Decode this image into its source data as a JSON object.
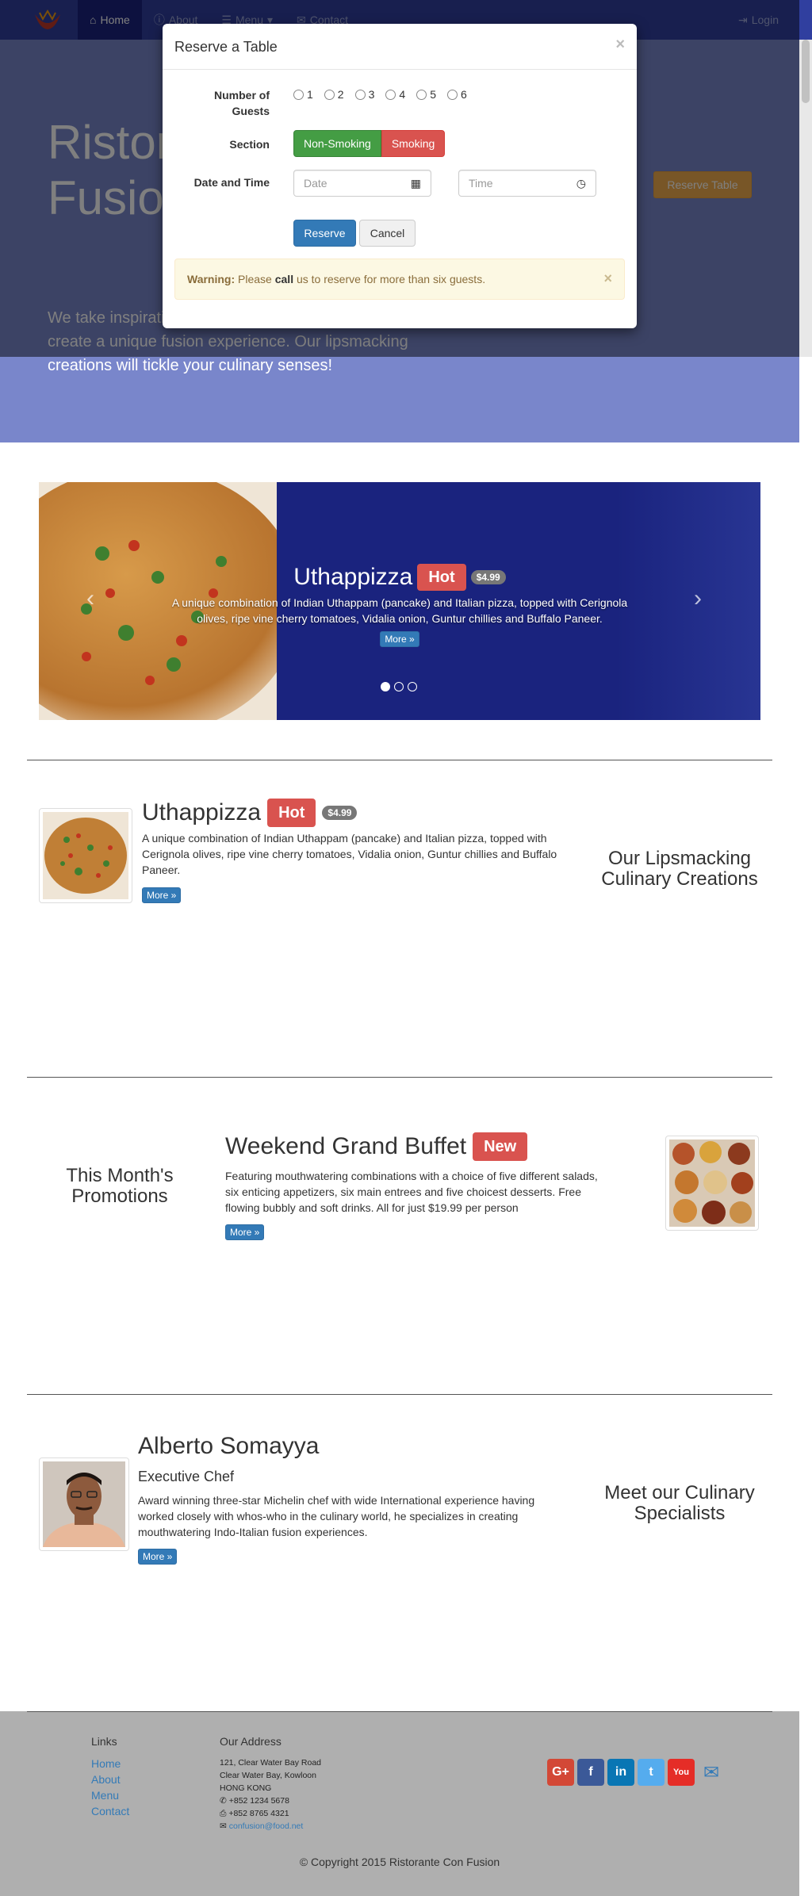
{
  "navbar": {
    "items": [
      {
        "label": "Home",
        "icon": "home-icon"
      },
      {
        "label": "About",
        "icon": "info-icon"
      },
      {
        "label": "Menu",
        "icon": "list-icon"
      },
      {
        "label": "Contact",
        "icon": "envelope-icon"
      }
    ],
    "login_label": "Login",
    "colors": {
      "primary": "#303f9f",
      "active": "#1a237e",
      "link": "#9fa8da"
    }
  },
  "header": {
    "title_line1": "Ristorante con",
    "title_line2": "Fusion",
    "reserve_label": "Reserve Table",
    "text": "We take inspiration from the World's best cuisines, and create a unique fusion experience. Our lipsmacking creations will tickle your culinary senses!"
  },
  "modal": {
    "title": "Reserve a Table",
    "close": "×",
    "guests_label_1": "Number of",
    "guests_label_2": "Guests",
    "guest_options": [
      "1",
      "2",
      "3",
      "4",
      "5",
      "6"
    ],
    "section_label": "Section",
    "section_options": [
      "Non-Smoking",
      "Smoking"
    ],
    "datetime_label": "Date and Time",
    "date_placeholder": "Date",
    "time_placeholder": "Time",
    "reserve_label": "Reserve",
    "cancel_label": "Cancel",
    "alert": {
      "strong": "Warning:",
      "pre": " Please ",
      "bold": "call",
      "post": " us to reserve for more than six guests.",
      "close": "×"
    }
  },
  "carousel": {
    "title": "Uthappizza",
    "label": "Hot",
    "price": "$4.99",
    "text": "A unique combination of Indian Uthappam (pancake) and Italian pizza, topped with Cerignola olives, ripe vine cherry tomatoes, Vidalia onion, Guntur chillies and Buffalo Paneer.",
    "more": "More »",
    "prev": "‹",
    "next": "›"
  },
  "dish": {
    "title": "Uthappizza",
    "label": "Hot",
    "price": "$4.99",
    "text": "A unique combination of Indian Uthappam (pancake) and Italian pizza, topped with Cerignola olives, ripe vine cherry tomatoes, Vidalia onion, Guntur chillies and Buffalo Paneer.",
    "more": "More »",
    "side_heading_1": "Our Lipsmacking",
    "side_heading_2": "Culinary Creations"
  },
  "promotion": {
    "side_heading_1": "This Month's",
    "side_heading_2": "Promotions",
    "title": "Weekend Grand Buffet",
    "label": "New",
    "text": "Featuring mouthwatering combinations with a choice of five different salads, six enticing appetizers, six main entrees and five choicest desserts. Free flowing bubbly and soft drinks. All for just $19.99 per person",
    "more": "More »"
  },
  "chef": {
    "name": "Alberto Somayya",
    "role": "Executive Chef",
    "text": "Award winning three-star Michelin chef with wide International experience having worked closely with whos-who in the culinary world, he specializes in creating mouthwatering Indo-Italian fusion experiences.",
    "more": "More »",
    "side_heading_1": "Meet our Culinary",
    "side_heading_2": "Specialists"
  },
  "footer": {
    "links_heading": "Links",
    "links": [
      "Home",
      "About",
      "Menu",
      "Contact"
    ],
    "address_heading": "Our Address",
    "address_lines": [
      "121, Clear Water Bay Road",
      "Clear Water Bay, Kowloon",
      "HONG KONG"
    ],
    "phone": "+852 1234 5678",
    "fax": "+852 8765 4321",
    "email": "confusion@food.net",
    "social": [
      {
        "name": "google-plus",
        "glyph": "G+",
        "color": "#d34836"
      },
      {
        "name": "facebook",
        "glyph": "f",
        "color": "#3b5998"
      },
      {
        "name": "linkedin",
        "glyph": "in",
        "color": "#0976b4"
      },
      {
        "name": "twitter",
        "glyph": "t",
        "color": "#55acee"
      },
      {
        "name": "youtube",
        "glyph": "You",
        "color": "#e52d27"
      }
    ],
    "copyright": "© Copyright 2015 Ristorante Con Fusion"
  }
}
